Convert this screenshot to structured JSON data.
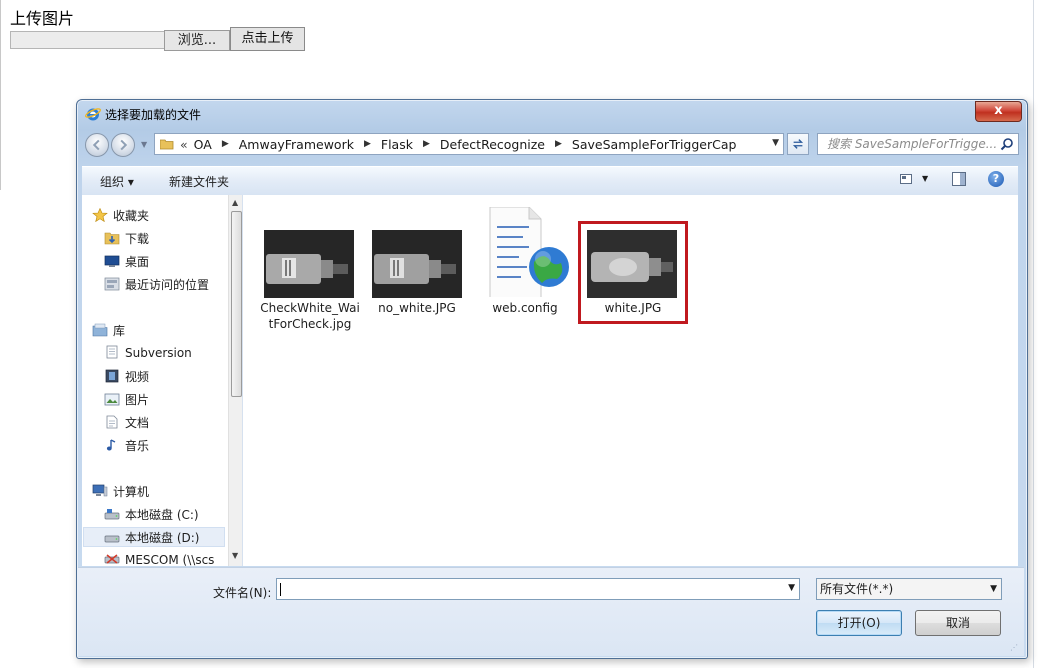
{
  "page": {
    "heading": "上传图片",
    "browse_label": "浏览...",
    "upload_label": "点击上传"
  },
  "dialog": {
    "title": "选择要加载的文件",
    "close_label": "x",
    "breadcrumbs": [
      "OA",
      "AmwayFramework",
      "Flask",
      "DefectRecognize",
      "SaveSampleForTriggerCap"
    ],
    "breadcrumb_prefix": "«",
    "search_placeholder": "搜索 SaveSampleForTrigge...",
    "toolbar": {
      "organize_label": "组织 ▾",
      "new_folder_label": "新建文件夹",
      "help_label": "?"
    },
    "nav": {
      "favorites": {
        "label": "收藏夹",
        "items": [
          "下载",
          "桌面",
          "最近访问的位置"
        ]
      },
      "libraries": {
        "label": "库",
        "items": [
          "Subversion",
          "视频",
          "图片",
          "文档",
          "音乐"
        ]
      },
      "computer": {
        "label": "计算机",
        "items": [
          "本地磁盘 (C:)",
          "本地磁盘 (D:)",
          "MESCOM (\\\\scs"
        ]
      },
      "selected_item": "本地磁盘 (D:)"
    },
    "files": [
      {
        "name": "CheckWhite_WaitForCheck.jpg",
        "kind": "image-thumbnail"
      },
      {
        "name": "no_white.JPG",
        "kind": "image-thumbnail"
      },
      {
        "name": "web.config",
        "kind": "config-file-icon"
      },
      {
        "name": "white.JPG",
        "kind": "image-thumbnail",
        "highlighted": true
      }
    ],
    "filename_label": "文件名(N):",
    "filename_value": "",
    "filetype_value": "所有文件(*.*)",
    "open_label": "打开(O)",
    "cancel_label": "取消"
  },
  "colors": {
    "highlight": "#c0191f",
    "dialog_frame": "#bfd4ec",
    "selection": "#e7eef8"
  }
}
